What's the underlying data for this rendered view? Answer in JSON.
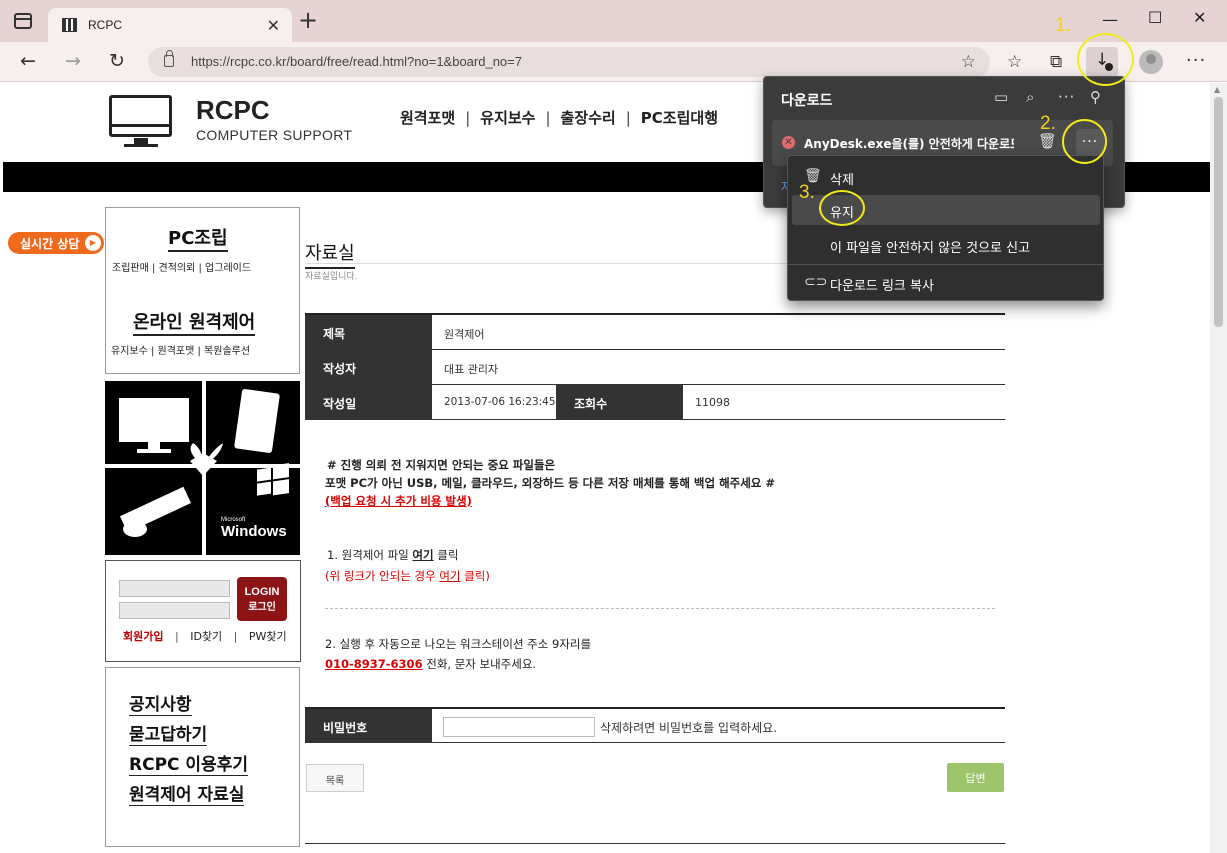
{
  "browser": {
    "tab_title": "RCPC",
    "url": "https://rcpc.co.kr/board/free/read.html?no=1&board_no=7"
  },
  "annotations": [
    "1.",
    "2.",
    "3."
  ],
  "site": {
    "logo_title": "RCPC",
    "logo_sub": "COMPUTER SUPPORT",
    "nav": [
      "원격포맷",
      "유지보수",
      "출장수리",
      "PC조립대행"
    ],
    "chat_label": "실시간 상담"
  },
  "sidebar": {
    "pc_head": "PC조립",
    "pc_sub": "조립판매 | 견적의뢰 | 업그레이드",
    "remote_head": "온라인 원격제어",
    "remote_sub": "유지보수 | 원격포맷 | 복원솔루션",
    "windows_brand": "Microsoft",
    "windows_label": "Windows",
    "login_label": "LOGIN",
    "login_sub": "로그인",
    "join": "회원가입",
    "find_id": "ID찾기",
    "find_pw": "PW찾기",
    "menu": [
      "공지사항",
      "묻고답하기",
      "RCPC 이용후기",
      "원격제어 자료실"
    ]
  },
  "post": {
    "section_title": "자료실",
    "section_desc": "자료실입니다.",
    "subject_label": "제목",
    "subject": "원격제어",
    "author_label": "작성자",
    "author": "대표 관리자",
    "date_label": "작성일",
    "date": "2013-07-06 16:23:45",
    "views_label": "조회수",
    "views": "11098",
    "notice_line1": "# 진행 의뢰 전 지워지면 안되는 중요 파일들은",
    "notice_line2": "포맷 PC가 아닌 USB, 메일, 클라우드, 외장하드 등 다른 저장 매체를 통해 백업 해주세요 #",
    "notice_line3": "(백업 요청 시 추가 비용 발생)",
    "step1_prefix": "1.  원격제어 파일 ",
    "step1_link": "여기",
    "step1_suffix": " 클릭",
    "step1_alt_prefix": "(위 링크가 안되는 경우 ",
    "step1_alt_link": "여기",
    "step1_alt_suffix": " 클릭)",
    "step2_line": "2. 실행 후 자동으로 나오는 워크스테이션 주소 9자리를",
    "phone": "010-8937-6306",
    "step2_suffix": " 전화, 문자 보내주세요.",
    "password_label": "비밀번호",
    "password_hint": "삭제하려면 비밀번호를 입력하세요.",
    "list_button": "목록",
    "reply_button": "답변"
  },
  "downloads": {
    "title": "다운로드",
    "item_name": "AnyDesk.exe을(를) 안전하게 다운로드할 수 없습니다",
    "link_fragment": "자",
    "menu": [
      "삭제",
      "유지",
      "이 파일을 안전하지 않은 것으로 신고",
      "다운로드 링크 복사"
    ]
  }
}
